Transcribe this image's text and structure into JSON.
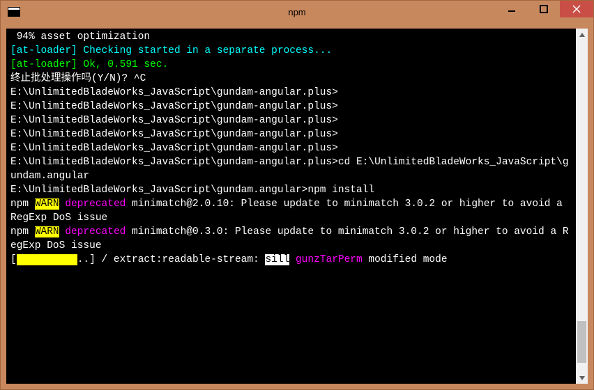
{
  "window": {
    "title": "npm"
  },
  "terminal": {
    "lines": {
      "l1": " 94% asset optimization",
      "l2": "[at-loader] Checking started in a separate process...",
      "l3": "",
      "l4_a": "[at-loader] ",
      "l4_b": "Ok, 0.591 sec.",
      "l5": "终止批处理操作吗(Y/N)? ^C",
      "l6": "",
      "l7": "E:\\UnlimitedBladeWorks_JavaScript\\gundam-angular.plus>",
      "l8": "",
      "l9": "E:\\UnlimitedBladeWorks_JavaScript\\gundam-angular.plus>",
      "l10": "",
      "l11": "E:\\UnlimitedBladeWorks_JavaScript\\gundam-angular.plus>",
      "l12": "",
      "l13": "E:\\UnlimitedBladeWorks_JavaScript\\gundam-angular.plus>",
      "l14": "",
      "l15": "E:\\UnlimitedBladeWorks_JavaScript\\gundam-angular.plus>",
      "l16": "",
      "l17": "E:\\UnlimitedBladeWorks_JavaScript\\gundam-angular.plus>cd E:\\UnlimitedBladeWorks_JavaScript\\gundam.angular",
      "l18": "",
      "l19": "E:\\UnlimitedBladeWorks_JavaScript\\gundam.angular>npm install",
      "l20_npm": "npm ",
      "l20_warn": "WARN",
      "l20_dep": " deprecated",
      "l20_rest": " minimatch@2.0.10: Please update to minimatch 3.0.2 or higher to avoid a RegExp DoS issue",
      "l21_npm": "npm ",
      "l21_warn": "WARN",
      "l21_dep": " deprecated",
      "l21_rest": " minimatch@0.3.0: Please update to minimatch 3.0.2 or higher to avoid a RegExp DoS issue",
      "l22_a": "[",
      "l22_prog": "          ",
      "l22_b": "..] / extract:readable-stream: ",
      "l22_sill": "sill",
      "l22_c": " ",
      "l22_gun": "gunzTarPerm",
      "l22_d": " modified mode"
    }
  }
}
